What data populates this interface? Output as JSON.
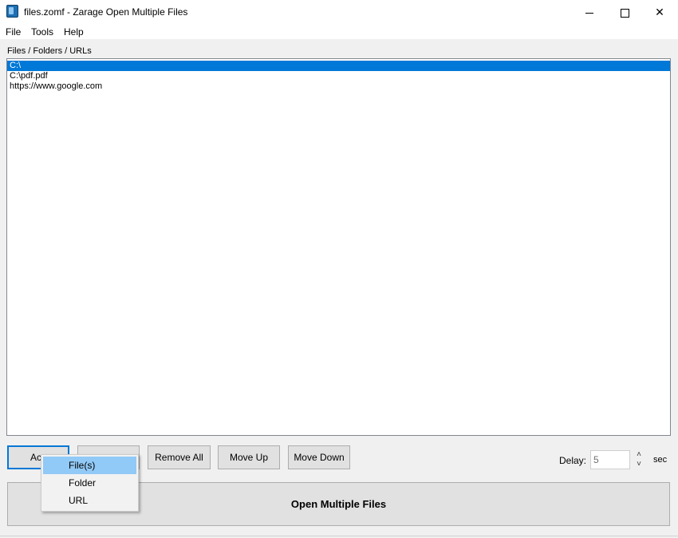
{
  "window": {
    "title": "files.zomf - Zarage Open Multiple Files",
    "controls": {
      "minimize_icon": "minimize-icon",
      "maximize_icon": "maximize-icon",
      "close_icon": "close-icon",
      "close_glyph": "✕"
    }
  },
  "menu": {
    "items": [
      {
        "label": "File"
      },
      {
        "label": "Tools"
      },
      {
        "label": "Help"
      }
    ]
  },
  "list": {
    "label": "Files / Folders / URLs",
    "items": [
      {
        "text": "C:\\",
        "selected": true
      },
      {
        "text": "C:\\pdf.pdf",
        "selected": false
      },
      {
        "text": "https://www.google.com",
        "selected": false
      }
    ],
    "selected_color": "#0078d7"
  },
  "buttons": {
    "add": "Ac",
    "remove": "",
    "remove_all": "Remove All",
    "move_up": "Move Up",
    "move_down": "Move Down",
    "open": "Open Multiple Files"
  },
  "delay": {
    "label": "Delay:",
    "value": "5",
    "unit": "sec",
    "spin_up": "˄",
    "spin_down": "˅"
  },
  "add_menu": {
    "items": [
      {
        "label": "File(s)",
        "highlighted": true
      },
      {
        "label": "Folder",
        "highlighted": false
      },
      {
        "label": "URL",
        "highlighted": false
      }
    ],
    "highlight_color": "#91c9f7"
  }
}
